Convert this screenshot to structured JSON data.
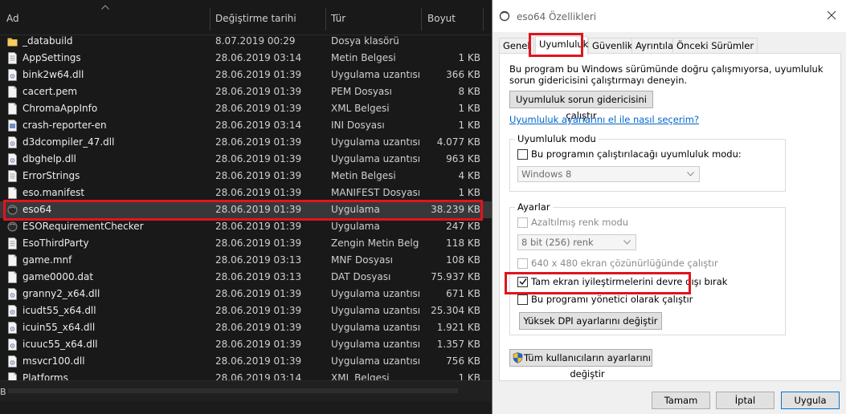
{
  "explorer": {
    "columns": {
      "name": "Ad",
      "date": "Değiştirme tarihi",
      "type": "Tür",
      "size": "Boyut"
    },
    "files": [
      {
        "name": "_databuild",
        "date": "8.07.2019 00:29",
        "type": "Dosya klasörü",
        "size": "",
        "icon": "folder-icon"
      },
      {
        "name": "AppSettings",
        "date": "28.06.2019 03:14",
        "type": "Metin Belgesi",
        "size": "1 KB",
        "icon": "text-file-icon"
      },
      {
        "name": "bink2w64.dll",
        "date": "28.06.2019 01:39",
        "type": "Uygulama uzantısı",
        "size": "366 KB",
        "icon": "dll-file-icon"
      },
      {
        "name": "cacert.pem",
        "date": "28.06.2019 01:39",
        "type": "PEM Dosyası",
        "size": "8 KB",
        "icon": "file-icon"
      },
      {
        "name": "ChromaAppInfo",
        "date": "28.06.2019 01:39",
        "type": "XML Belgesi",
        "size": "1 KB",
        "icon": "file-icon"
      },
      {
        "name": "crash-reporter-en",
        "date": "28.06.2019 03:14",
        "type": "INI Dosyası",
        "size": "1 KB",
        "icon": "settings-file-icon"
      },
      {
        "name": "d3dcompiler_47.dll",
        "date": "28.06.2019 01:39",
        "type": "Uygulama uzantısı",
        "size": "4.077 KB",
        "icon": "dll-file-icon"
      },
      {
        "name": "dbghelp.dll",
        "date": "28.06.2019 01:39",
        "type": "Uygulama uzantısı",
        "size": "963 KB",
        "icon": "dll-file-icon"
      },
      {
        "name": "ErrorStrings",
        "date": "28.06.2019 01:39",
        "type": "Metin Belgesi",
        "size": "4 KB",
        "icon": "text-file-icon"
      },
      {
        "name": "eso.manifest",
        "date": "28.06.2019 01:39",
        "type": "MANIFEST Dosyası",
        "size": "1 KB",
        "icon": "file-icon"
      },
      {
        "name": "eso64",
        "date": "28.06.2019 01:39",
        "type": "Uygulama",
        "size": "38.239 KB",
        "icon": "app-icon",
        "selected": true
      },
      {
        "name": "ESORequirementChecker",
        "date": "28.06.2019 01:39",
        "type": "Uygulama",
        "size": "247 KB",
        "icon": "app-icon"
      },
      {
        "name": "EsoThirdParty",
        "date": "28.06.2019 01:39",
        "type": "Zengin Metin Belg...",
        "size": "118 KB",
        "icon": "text-file-icon"
      },
      {
        "name": "game.mnf",
        "date": "28.06.2019 03:13",
        "type": "MNF Dosyası",
        "size": "108 KB",
        "icon": "file-icon"
      },
      {
        "name": "game0000.dat",
        "date": "28.06.2019 03:13",
        "type": "DAT Dosyası",
        "size": "75.937 KB",
        "icon": "file-icon"
      },
      {
        "name": "granny2_x64.dll",
        "date": "28.06.2019 01:39",
        "type": "Uygulama uzantısı",
        "size": "671 KB",
        "icon": "dll-file-icon"
      },
      {
        "name": "icudt55_x64.dll",
        "date": "28.06.2019 01:39",
        "type": "Uygulama uzantısı",
        "size": "25.304 KB",
        "icon": "dll-file-icon"
      },
      {
        "name": "icuin55_x64.dll",
        "date": "28.06.2019 01:39",
        "type": "Uygulama uzantısı",
        "size": "1.921 KB",
        "icon": "dll-file-icon"
      },
      {
        "name": "icuuc55_x64.dll",
        "date": "28.06.2019 01:39",
        "type": "Uygulama uzantısı",
        "size": "1.357 KB",
        "icon": "dll-file-icon"
      },
      {
        "name": "msvcr100.dll",
        "date": "28.06.2019 01:39",
        "type": "Uygulama uzantısı",
        "size": "756 KB",
        "icon": "dll-file-icon"
      },
      {
        "name": "Platforms",
        "date": "28.06.2019 03:14",
        "type": "XML Belgesi",
        "size": "1 KB",
        "icon": "file-icon"
      }
    ],
    "status_text": "B"
  },
  "dialog": {
    "title": "eso64 Özellikleri",
    "tabs": [
      "Genel",
      "Uyumluluk",
      "Güvenlik",
      "Ayrıntılar",
      "Önceki Sürümler"
    ],
    "active_tab": "Uyumluluk",
    "intro_line1": "Bu program bu Windows sürümünde doğru çalışmıyorsa, uyumluluk",
    "intro_line2": "sorun gidericisini çalıştırmayı deneyin.",
    "troubleshooter_button": "Uyumluluk sorun gidericisini çalıştır",
    "manual_link": "Uyumluluk ayarlarını el ile nasıl seçerim?",
    "compat_group": {
      "label": "Uyumluluk modu",
      "checkbox": "Bu programın çalıştırılacağı uyumluluk modu:",
      "checked": false,
      "os_value": "Windows 8"
    },
    "settings_group": {
      "label": "Ayarlar",
      "reduced_color": "Azaltılmış renk modu",
      "color_value": "8 bit (256) renk",
      "low_res": "640 x 480 ekran çözünürlüğünde çalıştır",
      "disable_fullscreen": "Tam ekran iyileştirmelerini devre dışı bırak",
      "disable_fullscreen_checked": true,
      "run_as_admin": "Bu programı yönetici olarak çalıştır",
      "run_as_admin_checked": false,
      "dpi_button": "Yüksek DPI ayarlarını değiştir"
    },
    "all_users_button": "Tüm kullanıcıların ayarlarını değiştir",
    "ok": "Tamam",
    "cancel": "İptal",
    "apply": "Uygula"
  },
  "colors": {
    "highlight": "#e0141e",
    "link": "#0066cc",
    "explorer_bg": "#191919",
    "dialog_bg": "#f0f0f0"
  }
}
